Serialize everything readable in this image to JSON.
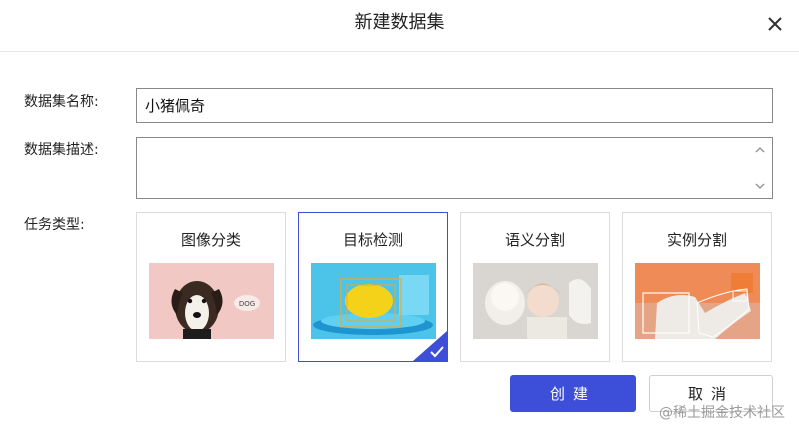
{
  "dialog": {
    "title": "新建数据集",
    "close_icon": "close-icon"
  },
  "form": {
    "name_label": "数据集名称:",
    "name_value": "小猪佩奇",
    "desc_label": "数据集描述:",
    "desc_value": "",
    "task_label": "任务类型:"
  },
  "tasks": [
    {
      "label": "图像分类",
      "selected": false,
      "image_text": "DOG"
    },
    {
      "label": "目标检测",
      "selected": true
    },
    {
      "label": "语义分割",
      "selected": false
    },
    {
      "label": "实例分割",
      "selected": false
    }
  ],
  "buttons": {
    "create": "创建",
    "cancel": "取消"
  },
  "watermark": "@稀土掘金技术社区",
  "colors": {
    "accent": "#3d4fd9",
    "border": "#dcdcdc"
  }
}
